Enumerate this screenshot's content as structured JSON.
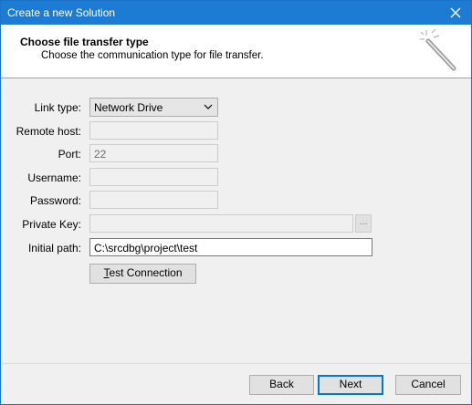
{
  "window": {
    "title": "Create a new Solution"
  },
  "header": {
    "title": "Choose file transfer type",
    "subtitle": "Choose the communication type for file transfer."
  },
  "form": {
    "link_type": {
      "label": "Link type:",
      "value": "Network Drive"
    },
    "remote_host": {
      "label": "Remote host:",
      "value": ""
    },
    "port": {
      "label": "Port:",
      "value": "22"
    },
    "username": {
      "label": "Username:",
      "value": ""
    },
    "password": {
      "label": "Password:",
      "value": ""
    },
    "private_key": {
      "label": "Private Key:",
      "value": "",
      "browse_label": "..."
    },
    "initial_path": {
      "label": "Initial path:",
      "value": "C:\\srcdbg\\project\\test"
    },
    "test_connection": {
      "prefix": "T",
      "rest": "est Connection"
    }
  },
  "footer": {
    "back_label": "Back",
    "next_label": "Next",
    "cancel_label": "Cancel"
  },
  "colors": {
    "titlebar": "#1e7bd4",
    "default_button_border": "#0078d7",
    "dialog_bg": "#f0f0f0"
  }
}
